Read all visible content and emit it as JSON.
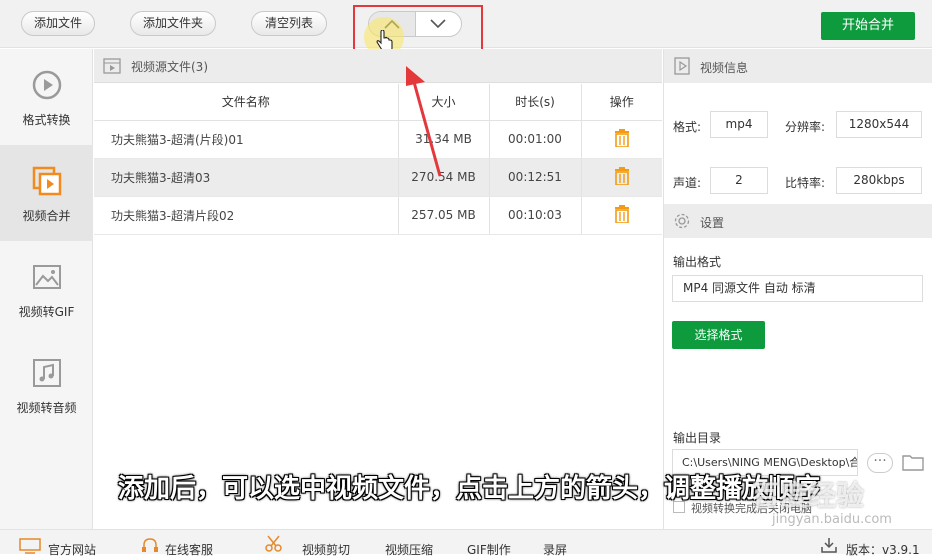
{
  "toolbar": {
    "add_file": "添加文件",
    "add_folder": "添加文件夹",
    "clear_list": "清空列表",
    "start_merge": "开始合并"
  },
  "sidebar": {
    "items": [
      {
        "label": "格式转换",
        "icon": "play-circle-icon"
      },
      {
        "label": "视频合并",
        "icon": "video-merge-icon",
        "active": true
      },
      {
        "label": "视频转GIF",
        "icon": "image-icon"
      },
      {
        "label": "视频转音频",
        "icon": "music-note-icon"
      }
    ]
  },
  "source": {
    "title": "视频源文件(3)",
    "columns": [
      "文件名称",
      "大小",
      "时长(s)",
      "操作"
    ],
    "rows": [
      {
        "name": "功夫熊猫3-超清(片段)01",
        "size": "31.34 MB",
        "duration": "00:01:00"
      },
      {
        "name": "功夫熊猫3-超清03",
        "size": "270.54 MB",
        "duration": "00:12:51"
      },
      {
        "name": "功夫熊猫3-超清片段02",
        "size": "257.05 MB",
        "duration": "00:10:03"
      }
    ]
  },
  "info": {
    "title": "视频信息",
    "format_label": "格式:",
    "format_value": "mp4",
    "resolution_label": "分辨率:",
    "resolution_value": "1280x544",
    "channel_label": "声道:",
    "channel_value": "2",
    "bitrate_label": "比特率:",
    "bitrate_value": "280kbps"
  },
  "settings": {
    "title": "设置",
    "output_format_label": "输出格式",
    "output_format_value": "MP4 同源文件 自动 标清",
    "select_format": "选择格式",
    "output_dir_label": "输出目录",
    "output_dir_value": "C:\\Users\\NING MENG\\Desktop\\合",
    "shutdown_label": "视频转换完成后关闭电脑"
  },
  "footer": {
    "official_site": "官方网站",
    "online_service": "在线客服",
    "video_cut": "视频剪切",
    "video_compress": "视频压缩",
    "gif_make": "GIF制作",
    "screen_record": "录屏",
    "version": "版本：v3.9.1"
  },
  "overlay": {
    "subtitle": "添加后，可以选中视频文件，点击上方的箭头，调整播放顺序",
    "watermark": "百度经验",
    "watermark_url": "jingyan.baidu.com"
  },
  "colors": {
    "accent_green": "#0d9b3e",
    "trash_orange": "#f39c12",
    "annotation_red": "#e4393c"
  }
}
